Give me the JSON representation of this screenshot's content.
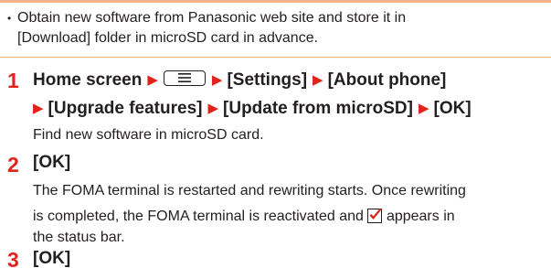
{
  "note": {
    "bullet": "•",
    "line1": "Obtain new software from Panasonic web site and store it in",
    "line2": "[Download] folder in microSD card in advance."
  },
  "steps": [
    {
      "number": "1",
      "line1_start": "Home screen",
      "line1_after_key": "[Settings]",
      "line1_item2": "[About phone]",
      "line2_item1": "[Upgrade features]",
      "line2_item2": "[Update from microSD]",
      "line2_item3": "[OK]",
      "description": "Find new software in microSD card."
    },
    {
      "number": "2",
      "action": "[OK]",
      "description_line1": "The FOMA terminal is restarted and rewriting starts. Once rewriting",
      "description_line2_start": "is completed, the FOMA terminal is reactivated and",
      "description_line2_end": "appears in",
      "description_line3": "the status bar."
    },
    {
      "number": "3",
      "action": "[OK]"
    }
  ],
  "colors": {
    "accent_red": "#e1241b",
    "rule_orange": "#f3b38a",
    "text": "#231f20"
  },
  "icons": {
    "arrow": "triangle-right-icon",
    "menu_key": "menu-key-icon",
    "status_flag": "update-checkmark-icon"
  }
}
